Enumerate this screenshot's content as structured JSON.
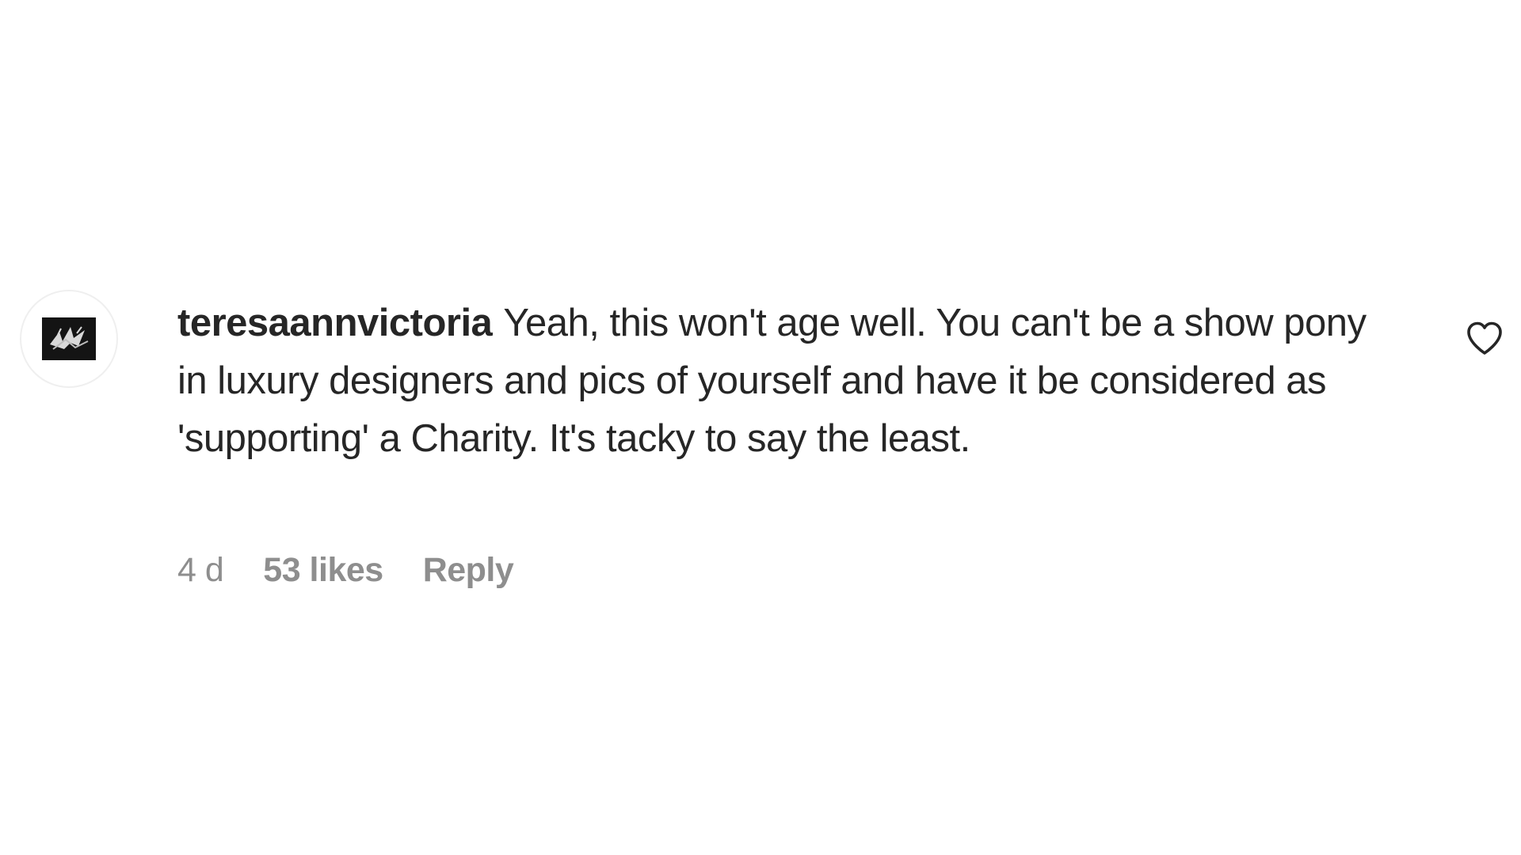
{
  "comment": {
    "username": "teresaannvictoria",
    "text": "Yeah, this won't age well. You can't be a show pony in luxury designers and pics of yourself and have it be considered as 'supporting' a Charity. It's tacky to say the least.",
    "time": "4 d",
    "likes": "53 likes",
    "reply_label": "Reply"
  },
  "icons": {
    "like": "heart-icon",
    "avatar": "profile-picture"
  },
  "colors": {
    "text": "#262626",
    "secondary": "#8e8e8e",
    "background": "#ffffff"
  }
}
